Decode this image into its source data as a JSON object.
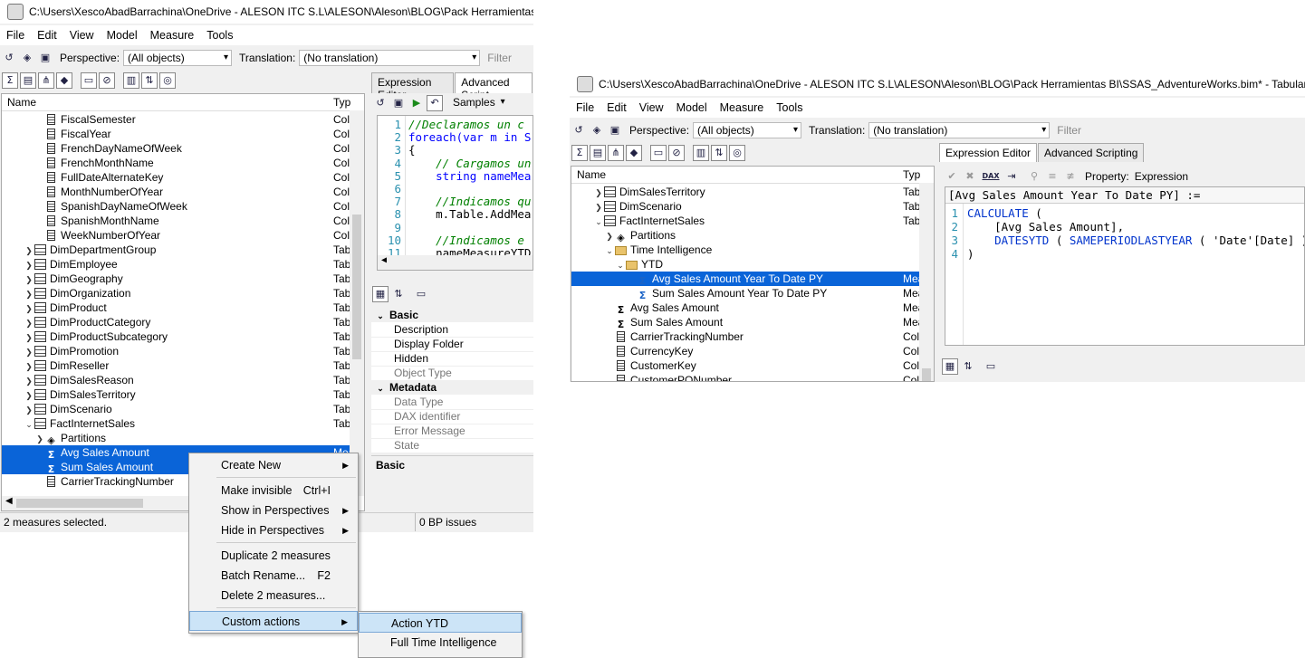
{
  "left": {
    "title": "C:\\Users\\XescoAbadBarrachina\\OneDrive - ALESON ITC S.L\\ALESON\\Aleson\\BLOG\\Pack Herramientas BI\\S",
    "menu": [
      "File",
      "Edit",
      "View",
      "Model",
      "Measure",
      "Tools"
    ],
    "perspective_label": "Perspective:",
    "perspective_value": "(All objects)",
    "translation_label": "Translation:",
    "translation_value": "(No translation)",
    "filter_placeholder": "Filter",
    "tree_header_name": "Name",
    "tree_header_type": "Typ",
    "rows": [
      {
        "label": "FiscalSemester",
        "icon": "column-icon",
        "type": "Colu",
        "indent": 2,
        "exp": ""
      },
      {
        "label": "FiscalYear",
        "icon": "column-icon",
        "type": "Colu",
        "indent": 2,
        "exp": ""
      },
      {
        "label": "FrenchDayNameOfWeek",
        "icon": "column-icon",
        "type": "Colu",
        "indent": 2,
        "exp": ""
      },
      {
        "label": "FrenchMonthName",
        "icon": "column-icon",
        "type": "Colu",
        "indent": 2,
        "exp": ""
      },
      {
        "label": "FullDateAlternateKey",
        "icon": "column-icon",
        "type": "Colu",
        "indent": 2,
        "exp": ""
      },
      {
        "label": "MonthNumberOfYear",
        "icon": "column-icon",
        "type": "Colu",
        "indent": 2,
        "exp": ""
      },
      {
        "label": "SpanishDayNameOfWeek",
        "icon": "column-icon",
        "type": "Colu",
        "indent": 2,
        "exp": ""
      },
      {
        "label": "SpanishMonthName",
        "icon": "column-icon",
        "type": "Colu",
        "indent": 2,
        "exp": ""
      },
      {
        "label": "WeekNumberOfYear",
        "icon": "column-icon",
        "type": "Colu",
        "indent": 2,
        "exp": ""
      },
      {
        "label": "DimDepartmentGroup",
        "icon": "table-icon",
        "type": "Tab",
        "indent": 1,
        "exp": ">"
      },
      {
        "label": "DimEmployee",
        "icon": "table-icon",
        "type": "Tab",
        "indent": 1,
        "exp": ">"
      },
      {
        "label": "DimGeography",
        "icon": "table-icon",
        "type": "Tab",
        "indent": 1,
        "exp": ">"
      },
      {
        "label": "DimOrganization",
        "icon": "table-icon",
        "type": "Tab",
        "indent": 1,
        "exp": ">"
      },
      {
        "label": "DimProduct",
        "icon": "table-icon",
        "type": "Tab",
        "indent": 1,
        "exp": ">"
      },
      {
        "label": "DimProductCategory",
        "icon": "table-icon",
        "type": "Tab",
        "indent": 1,
        "exp": ">"
      },
      {
        "label": "DimProductSubcategory",
        "icon": "table-icon",
        "type": "Tab",
        "indent": 1,
        "exp": ">"
      },
      {
        "label": "DimPromotion",
        "icon": "table-icon",
        "type": "Tab",
        "indent": 1,
        "exp": ">"
      },
      {
        "label": "DimReseller",
        "icon": "table-icon",
        "type": "Tab",
        "indent": 1,
        "exp": ">"
      },
      {
        "label": "DimSalesReason",
        "icon": "table-icon",
        "type": "Tab",
        "indent": 1,
        "exp": ">"
      },
      {
        "label": "DimSalesTerritory",
        "icon": "table-icon",
        "type": "Tab",
        "indent": 1,
        "exp": ">"
      },
      {
        "label": "DimScenario",
        "icon": "table-icon",
        "type": "Tab",
        "indent": 1,
        "exp": ">"
      },
      {
        "label": "FactInternetSales",
        "icon": "table-icon",
        "type": "Tab",
        "indent": 1,
        "exp": "v"
      },
      {
        "label": "Partitions",
        "icon": "partitions-icon",
        "type": "",
        "indent": 2,
        "exp": ">"
      },
      {
        "label": "Avg Sales Amount",
        "icon": "measure-icon",
        "type": "Mea",
        "indent": 2,
        "exp": "",
        "sel": true
      },
      {
        "label": "Sum Sales Amount",
        "icon": "measure-icon",
        "type": "",
        "indent": 2,
        "exp": "",
        "sel": true
      },
      {
        "label": "CarrierTrackingNumber",
        "icon": "column-icon",
        "type": "",
        "indent": 2,
        "exp": ""
      }
    ],
    "tabs": [
      "Expression Editor",
      "Advanced Script"
    ],
    "samples_label": "Samples",
    "code_lines": [
      {
        "n": "1",
        "t": "//Declaramos un c",
        "cls": "cm"
      },
      {
        "n": "2",
        "t": "foreach(var m in S",
        "cls": "kw"
      },
      {
        "n": "3",
        "t": "{",
        "cls": ""
      },
      {
        "n": "4",
        "t": "    // Cargamos un",
        "cls": "cm"
      },
      {
        "n": "5",
        "t": "    string nameMea",
        "cls": "kw"
      },
      {
        "n": "6",
        "t": "",
        "cls": ""
      },
      {
        "n": "7",
        "t": "    //Indicamos qu",
        "cls": "cm"
      },
      {
        "n": "8",
        "t": "    m.Table.AddMea",
        "cls": ""
      },
      {
        "n": "9",
        "t": "",
        "cls": ""
      },
      {
        "n": "10",
        "t": "    //Indicamos e",
        "cls": "cm"
      },
      {
        "n": "11",
        "t": "    nameMeasureYTD",
        "cls": ""
      }
    ],
    "prop_items": [
      {
        "k": "cat",
        "t": "Basic"
      },
      {
        "k": "pr",
        "t": "Description"
      },
      {
        "k": "pr",
        "t": "Display Folder"
      },
      {
        "k": "pr",
        "t": "Hidden"
      },
      {
        "k": "dis",
        "t": "Object Type"
      },
      {
        "k": "cat",
        "t": "Metadata"
      },
      {
        "k": "dis",
        "t": "Data Type"
      },
      {
        "k": "dis",
        "t": "DAX identifier"
      },
      {
        "k": "dis",
        "t": "Error Message"
      },
      {
        "k": "dis",
        "t": "State"
      }
    ],
    "prop_desc_title": "Basic",
    "status_left": "2 measures selected.",
    "status_right": "0 BP issues"
  },
  "context_menu": {
    "items": [
      {
        "label": "Create New",
        "shortcut": "",
        "submenu": true,
        "sep_after": true
      },
      {
        "label": "Make invisible",
        "shortcut": "Ctrl+I",
        "submenu": false
      },
      {
        "label": "Show in Perspectives",
        "shortcut": "",
        "submenu": true
      },
      {
        "label": "Hide in Perspectives",
        "shortcut": "",
        "submenu": true,
        "sep_after": true
      },
      {
        "label": "Duplicate 2 measures",
        "shortcut": "",
        "submenu": false
      },
      {
        "label": "Batch Rename...",
        "shortcut": "F2",
        "submenu": false
      },
      {
        "label": "Delete 2 measures...",
        "shortcut": "",
        "submenu": false,
        "sep_after": true
      },
      {
        "label": "Custom actions",
        "shortcut": "",
        "submenu": true,
        "hl": true
      }
    ],
    "submenu": [
      "Action YTD",
      "Full Time Intelligence"
    ]
  },
  "right": {
    "title": "C:\\Users\\XescoAbadBarrachina\\OneDrive - ALESON ITC S.L\\ALESON\\Aleson\\BLOG\\Pack Herramientas BI\\SSAS_AdventureWorks.bim* - Tabular Editor",
    "menu": [
      "File",
      "Edit",
      "View",
      "Model",
      "Measure",
      "Tools"
    ],
    "perspective_label": "Perspective:",
    "perspective_value": "(All objects)",
    "translation_label": "Translation:",
    "translation_value": "(No translation)",
    "filter_placeholder": "Filter",
    "tree_header_name": "Name",
    "tree_header_type": "Typ",
    "rows": [
      {
        "label": "DimSalesTerritory",
        "icon": "table-icon",
        "type": "Tab",
        "indent": 1,
        "exp": ">"
      },
      {
        "label": "DimScenario",
        "icon": "table-icon",
        "type": "Tab",
        "indent": 1,
        "exp": ">"
      },
      {
        "label": "FactInternetSales",
        "icon": "table-icon",
        "type": "Tab",
        "indent": 1,
        "exp": "v"
      },
      {
        "label": "Partitions",
        "icon": "partitions-icon",
        "type": "",
        "indent": 2,
        "exp": ">"
      },
      {
        "label": "Time Intelligence",
        "icon": "folder-icon",
        "type": "",
        "indent": 2,
        "exp": "v"
      },
      {
        "label": "YTD",
        "icon": "folder-icon",
        "type": "",
        "indent": 3,
        "exp": "v"
      },
      {
        "label": "Avg Sales Amount Year To Date PY",
        "icon": "measure-info-icon",
        "type": "Mea",
        "indent": 4,
        "exp": "",
        "sel": true
      },
      {
        "label": "Sum Sales Amount Year To Date PY",
        "icon": "measure-info-icon",
        "type": "Mea",
        "indent": 4,
        "exp": ""
      },
      {
        "label": "Avg Sales Amount",
        "icon": "measure-icon",
        "type": "Mea",
        "indent": 2,
        "exp": ""
      },
      {
        "label": "Sum Sales Amount",
        "icon": "measure-icon",
        "type": "Mea",
        "indent": 2,
        "exp": ""
      },
      {
        "label": "CarrierTrackingNumber",
        "icon": "column-icon",
        "type": "Colu",
        "indent": 2,
        "exp": ""
      },
      {
        "label": "CurrencyKey",
        "icon": "column-icon",
        "type": "Colu",
        "indent": 2,
        "exp": ""
      },
      {
        "label": "CustomerKey",
        "icon": "column-icon",
        "type": "Colu",
        "indent": 2,
        "exp": ""
      },
      {
        "label": "CustomerPONumber",
        "icon": "column-icon",
        "type": "Colu",
        "indent": 2,
        "exp": ""
      }
    ],
    "tabs": [
      "Expression Editor",
      "Advanced Scripting"
    ],
    "property_label": "Property:",
    "property_value": "Expression",
    "dax_label": "DAX",
    "expr_header": "[Avg Sales Amount Year To Date PY] :=",
    "dax_lines": [
      {
        "n": "1",
        "parts": [
          {
            "t": "CALCULATE ",
            "c": "fn"
          },
          {
            "t": "(",
            "c": ""
          }
        ]
      },
      {
        "n": "2",
        "parts": [
          {
            "t": "    [Avg Sales Amount],",
            "c": ""
          }
        ]
      },
      {
        "n": "3",
        "parts": [
          {
            "t": "    DATESYTD ",
            "c": "fn"
          },
          {
            "t": "( ",
            "c": ""
          },
          {
            "t": "SAMEPERIODLASTYEAR ",
            "c": "fn"
          },
          {
            "t": "( 'Date'[Date] ) )",
            "c": ""
          }
        ]
      },
      {
        "n": "4",
        "parts": [
          {
            "t": ")",
            "c": ""
          }
        ]
      }
    ]
  }
}
